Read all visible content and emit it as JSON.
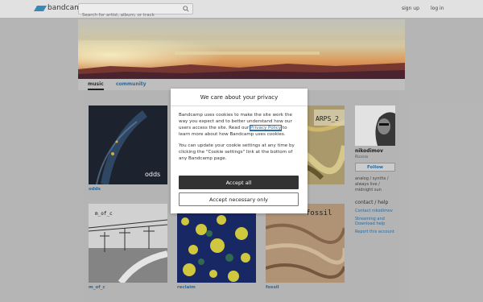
{
  "header": {
    "logo_text": "bandcamp",
    "search_placeholder": "Search for artist, album, or track",
    "signup": "sign up",
    "login": "log in"
  },
  "tabs": {
    "music": "music",
    "community": "community"
  },
  "albums": [
    {
      "title": "odds",
      "cover_text": "odds"
    },
    {
      "title": "",
      "cover_text": "ARPS_2"
    },
    {
      "title": "m_of_c",
      "cover_text": "m_of_c"
    },
    {
      "title": "reclaim",
      "cover_text": ""
    },
    {
      "title": "fossil",
      "cover_text": "fossil"
    }
  ],
  "artist": {
    "name": "nikodimov",
    "location": "Russia",
    "follow": "Follow",
    "tags": [
      "analog / synths /",
      "always live /",
      "midnight sun"
    ],
    "contact_heading": "contact / help",
    "links": [
      "Contact nikodimov",
      "Streaming and Download help",
      "Report this account"
    ]
  },
  "cookie_modal": {
    "title": "We care about your privacy",
    "para1_before": "Bandcamp uses cookies to make the site work the way you expect and to better understand how our users access the site. Read our ",
    "privacy_link": "Privacy Policy",
    "para1_after": " to learn more about how Bandcamp uses cookies.",
    "para2": "You can update your cookie settings at any time by clicking the \"Cookie settings\" link at the bottom of any Bandcamp page.",
    "accept_all": "Accept all",
    "accept_necessary": "Accept necessary only"
  }
}
